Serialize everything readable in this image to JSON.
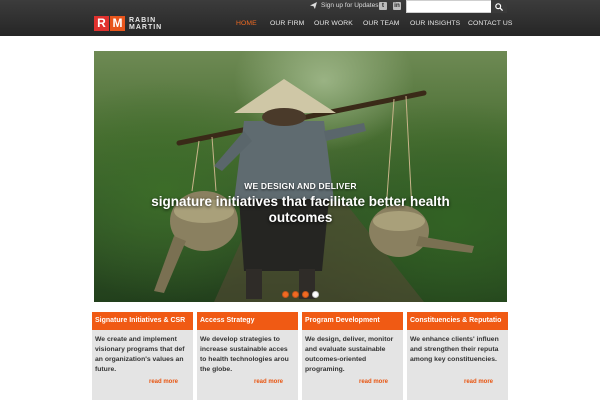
{
  "header": {
    "logo": {
      "letters": [
        "R",
        "M"
      ],
      "line1": "RABIN",
      "line2": "MARTIN"
    },
    "signup_label": "Sign up for Updates",
    "social": [
      {
        "icon": "twitter-icon",
        "glyph": "t"
      },
      {
        "icon": "linkedin-icon",
        "glyph": "in"
      }
    ],
    "search": {
      "placeholder": "",
      "value": ""
    },
    "nav": [
      {
        "label": "HOME",
        "active": true
      },
      {
        "label": "OUR FIRM",
        "active": false
      },
      {
        "label": "OUR WORK",
        "active": false
      },
      {
        "label": "OUR TEAM",
        "active": false
      },
      {
        "label": "OUR INSIGHTS",
        "active": false
      },
      {
        "label": "CONTACT US",
        "active": false
      }
    ]
  },
  "hero": {
    "kicker": "WE DESIGN AND DELIVER",
    "title": "signature initiatives that facilitate better health outcomes",
    "slides_total": 4,
    "active_slide": 4
  },
  "cards": [
    {
      "title": "Signature Initiatives & CSR",
      "lines": [
        "We create and implement",
        "visionary programs that def",
        "an organization's values an",
        "future."
      ],
      "more": "read more"
    },
    {
      "title": "Access Strategy",
      "lines": [
        "We develop strategies to",
        "increase sustainable acces",
        "to health technologies arou",
        "the globe."
      ],
      "more": "read more"
    },
    {
      "title": "Program Development",
      "lines": [
        "We design, deliver, monitor",
        "and evaluate sustainable",
        "outcomes-oriented",
        "programing."
      ],
      "more": "read more"
    },
    {
      "title": "Constituencies & Reputatio",
      "lines": [
        "We enhance clients' influen",
        "and strengthen their reputa",
        "among key constituencies."
      ],
      "more": "read more"
    }
  ],
  "colors": {
    "accent": "#f05a14",
    "nav_active": "#f06a22",
    "header_bg": "#2e2e2e",
    "card_bg": "#e4e4e4"
  }
}
